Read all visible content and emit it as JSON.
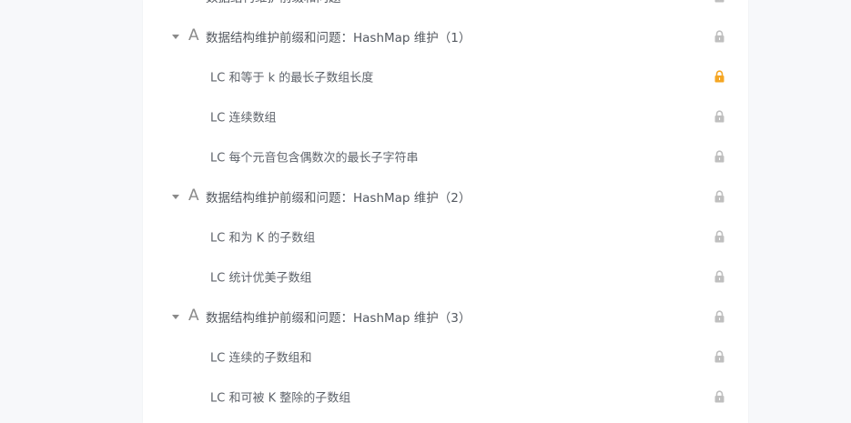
{
  "colors": {
    "lock_default": "#bfbfbf",
    "lock_active": "#f5a623",
    "text_primary": "#555a61",
    "background": "#f7f8fa",
    "card": "#ffffff"
  },
  "outline": {
    "items": [
      {
        "kind": "section",
        "icon": "A",
        "title": "数据结构维护前缀和问题",
        "lock": "lock-icon",
        "locked_color": "default"
      },
      {
        "kind": "section",
        "icon": "A",
        "title": "数据结构维护前缀和问题：HashMap 维护（1）",
        "lock": "lock-icon",
        "locked_color": "default"
      },
      {
        "kind": "lesson",
        "title": "LC 和等于 k 的最长子数组长度",
        "lock": "lock-icon",
        "locked_color": "active"
      },
      {
        "kind": "lesson",
        "title": "LC 连续数组",
        "lock": "lock-icon",
        "locked_color": "default"
      },
      {
        "kind": "lesson",
        "title": "LC 每个元音包含偶数次的最长子字符串",
        "lock": "lock-icon",
        "locked_color": "default"
      },
      {
        "kind": "section",
        "icon": "A",
        "title": "数据结构维护前缀和问题：HashMap 维护（2）",
        "lock": "lock-icon",
        "locked_color": "default"
      },
      {
        "kind": "lesson",
        "title": "LC 和为 K 的子数组",
        "lock": "lock-icon",
        "locked_color": "default"
      },
      {
        "kind": "lesson",
        "title": "LC 统计优美子数组",
        "lock": "lock-icon",
        "locked_color": "default"
      },
      {
        "kind": "section",
        "icon": "A",
        "title": "数据结构维护前缀和问题：HashMap 维护（3）",
        "lock": "lock-icon",
        "locked_color": "default"
      },
      {
        "kind": "lesson",
        "title": "LC 连续的子数组和",
        "lock": "lock-icon",
        "locked_color": "default"
      },
      {
        "kind": "lesson",
        "title": "LC 和可被 K 整除的子数组",
        "lock": "lock-icon",
        "locked_color": "default"
      }
    ]
  }
}
